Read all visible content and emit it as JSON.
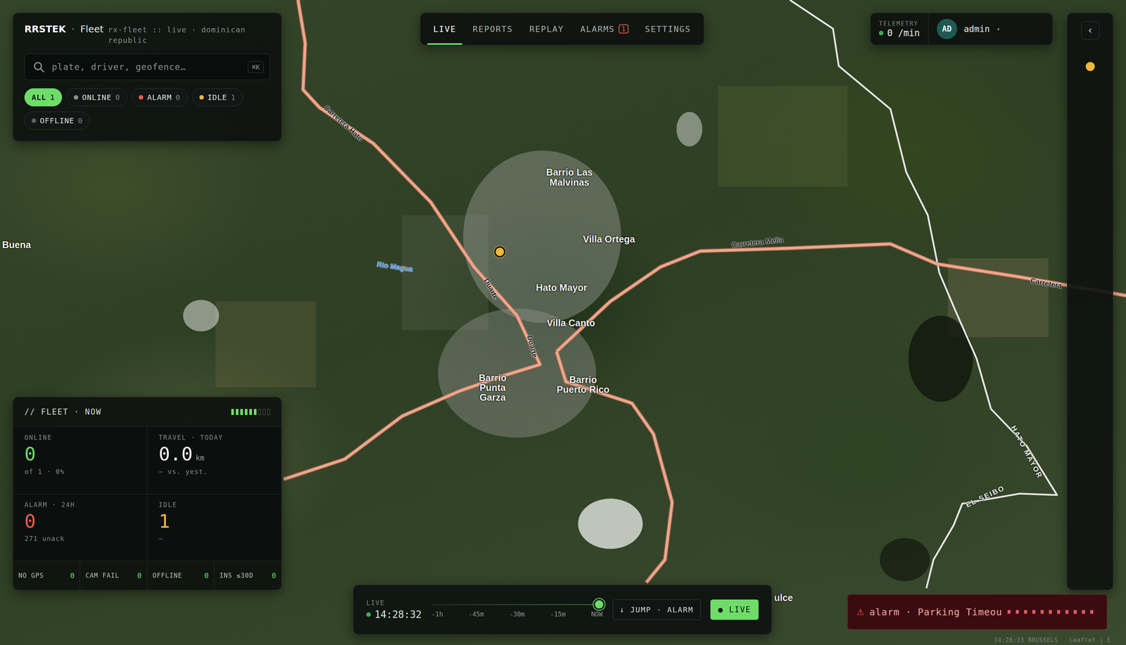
{
  "brand": {
    "name": "RRSTEK",
    "separator": "·",
    "product": "Fleet",
    "context": "rx-fleet :: live · dominican republic"
  },
  "search": {
    "placeholder": "plate, driver, geofence…",
    "shortcut": "⌘K"
  },
  "filters": [
    {
      "label": "ALL",
      "count": "1",
      "selected": true,
      "kind": "plain"
    },
    {
      "label": "ONLINE",
      "count": "0",
      "selected": false,
      "kind": "dot",
      "color": "#8a8f8c"
    },
    {
      "label": "ALARM",
      "count": "0",
      "selected": false,
      "kind": "dot",
      "color": "#ef5b4f"
    },
    {
      "label": "IDLE",
      "count": "1",
      "selected": false,
      "kind": "dot",
      "color": "#f0b73a"
    },
    {
      "label": "OFFLINE",
      "count": "0",
      "selected": false,
      "kind": "dot",
      "color": "#5d6360"
    }
  ],
  "nav": [
    {
      "label": "LIVE",
      "selected": true
    },
    {
      "label": "REPORTS",
      "selected": false
    },
    {
      "label": "REPLAY",
      "selected": false
    },
    {
      "label": "ALARMS",
      "selected": false,
      "badge": "1"
    },
    {
      "label": "SETTINGS",
      "selected": false
    }
  ],
  "telemetry": {
    "label": "TELEMETRY",
    "value": "0 /min"
  },
  "user": {
    "initials": "AD",
    "name": "admin",
    "caret": "▾"
  },
  "rail": {
    "collapse": "‹",
    "vehicles": [
      {
        "status": "idle",
        "color": "#f0b73a"
      }
    ]
  },
  "map": {
    "labels": [
      {
        "text": "Buena",
        "kind": "place"
      },
      {
        "text": "Carretera Hato",
        "kind": "road"
      },
      {
        "text": "Rio Magua",
        "kind": "water"
      },
      {
        "text": "Duarte",
        "kind": "road"
      },
      {
        "text": "Barrio Las Malvinas",
        "kind": "place"
      },
      {
        "text": "Villa Ortega",
        "kind": "place"
      },
      {
        "text": "Hato Mayor",
        "kind": "place"
      },
      {
        "text": "Villa Canto",
        "kind": "place"
      },
      {
        "text": "Duarte",
        "kind": "road"
      },
      {
        "text": "Barrio Punta Garza",
        "kind": "place"
      },
      {
        "text": "Barrio Puerto Rico",
        "kind": "place"
      },
      {
        "text": "Carretera Mella",
        "kind": "road"
      },
      {
        "text": "Carretera",
        "kind": "road"
      },
      {
        "text": "HATO MAYOR",
        "kind": "region"
      },
      {
        "text": "EL SEIBO",
        "kind": "region"
      },
      {
        "text": "ulce",
        "kind": "place"
      }
    ],
    "vehicles": [
      {
        "status": "idle",
        "color": "#f0b73a"
      }
    ]
  },
  "fleet": {
    "title": "// FLEET · NOW",
    "meter": {
      "level": 0.67
    },
    "stats": [
      {
        "label": "ONLINE",
        "value": "0",
        "sub": "of 1 · 0%",
        "color": "#6fdc6a"
      },
      {
        "label": "TRAVEL · TODAY",
        "value": "0.0",
        "unit": "km",
        "sub": "— vs. yest.",
        "color": "#f2f2ee"
      },
      {
        "label": "ALARM · 24H",
        "value": "0",
        "sub": "271 unack",
        "color": "#ef5b4f"
      },
      {
        "label": "IDLE",
        "value": "1",
        "sub": "—",
        "color": "#f0b73a"
      }
    ],
    "counters": [
      {
        "label": "NO GPS",
        "value": "0"
      },
      {
        "label": "CAM FAIL",
        "value": "0"
      },
      {
        "label": "OFFLINE",
        "value": "0"
      },
      {
        "label": "INS ≤30D",
        "value": "0"
      }
    ]
  },
  "timeline": {
    "mode": "LIVE",
    "time": "14:28:32",
    "level": 1,
    "ticks": [
      "-1h",
      "-45m",
      "-30m",
      "-15m",
      "NOW"
    ],
    "jump": "↓ JUMP · ALARM",
    "live": "● LIVE"
  },
  "toast": {
    "icon": "⚠",
    "text": "alarm · Parking Timeou"
  },
  "attribution": {
    "clock": "14:28:33 BRUSSELS",
    "credit": "Leaflet | E"
  }
}
